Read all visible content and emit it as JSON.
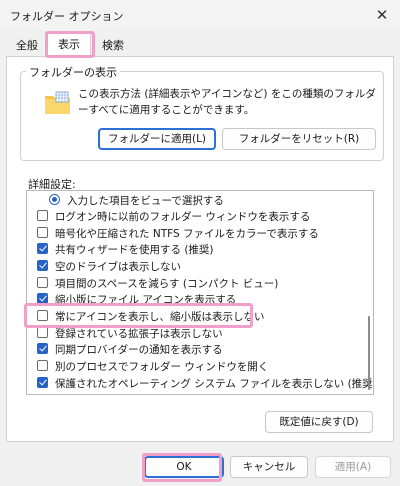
{
  "window": {
    "title": "フォルダー オプション"
  },
  "tabs": [
    {
      "label": "全般"
    },
    {
      "label": "表示"
    },
    {
      "label": "検索"
    }
  ],
  "folder_views": {
    "label": "フォルダーの表示",
    "description": "この表示方法 (詳細表示やアイコンなど) をこの種類のフォルダーすべてに適用することができます。",
    "apply_button": "フォルダーに適用(L)",
    "reset_button": "フォルダーをリセット(R)"
  },
  "advanced": {
    "label": "詳細設定:",
    "items": [
      {
        "text": "入力した項目をビューで選択する",
        "type": "radio",
        "checked": true
      },
      {
        "text": "ログオン時に以前のフォルダー ウィンドウを表示する",
        "type": "checkbox",
        "checked": false
      },
      {
        "text": "暗号化や圧縮された NTFS ファイルをカラーで表示する",
        "type": "checkbox",
        "checked": false
      },
      {
        "text": "共有ウィザードを使用する (推奨)",
        "type": "checkbox",
        "checked": true
      },
      {
        "text": "空のドライブは表示しない",
        "type": "checkbox",
        "checked": true
      },
      {
        "text": "項目間のスペースを減らす (コンパクト ビュー)",
        "type": "checkbox",
        "checked": false
      },
      {
        "text": "縮小版にファイル アイコンを表示する",
        "type": "checkbox",
        "checked": true
      },
      {
        "text": "常にアイコンを表示し、縮小版は表示しない",
        "type": "checkbox",
        "checked": false
      },
      {
        "text": "登録されている拡張子は表示しない",
        "type": "checkbox",
        "checked": false
      },
      {
        "text": "同期プロバイダーの通知を表示する",
        "type": "checkbox",
        "checked": true
      },
      {
        "text": "別のプロセスでフォルダー ウィンドウを開く",
        "type": "checkbox",
        "checked": false
      },
      {
        "text": "保護されたオペレーティング システム ファイルを表示しない (推奨)",
        "type": "checkbox",
        "checked": true
      }
    ],
    "restore_defaults": "既定値に戻す(D)"
  },
  "footer": {
    "ok": "OK",
    "cancel": "キャンセル",
    "apply": "適用(A)"
  },
  "colors": {
    "accent": "#2563c7",
    "highlight": "#f0a0c8"
  }
}
